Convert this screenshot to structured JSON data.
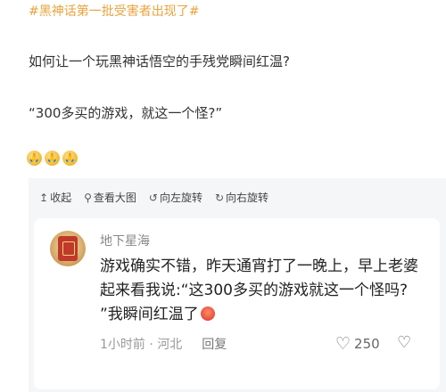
{
  "post": {
    "hashtag": "#黑神话第一批受害者出现了#",
    "question": "如何让一个玩黑神话悟空的手残党瞬间红温?",
    "quote": "“300多买的游戏，就这一个怪?”"
  },
  "emojis": [
    "pray-icon",
    "pray-icon",
    "pray-icon"
  ],
  "toolbar": {
    "collapse": "收起",
    "view_large": "查看大图",
    "rotate_left": "向左旋转",
    "rotate_right": "向右旋转"
  },
  "comment": {
    "username": "地下星海",
    "text": "游戏确实不错，昨天通宵打了一晚上，早上老婆起来看我说:“这300多买的游戏就这一个怪吗? ”我瞬间红温了",
    "time_location": "1小时前 · 河北",
    "reply_label": "回复",
    "like_count": "250"
  }
}
